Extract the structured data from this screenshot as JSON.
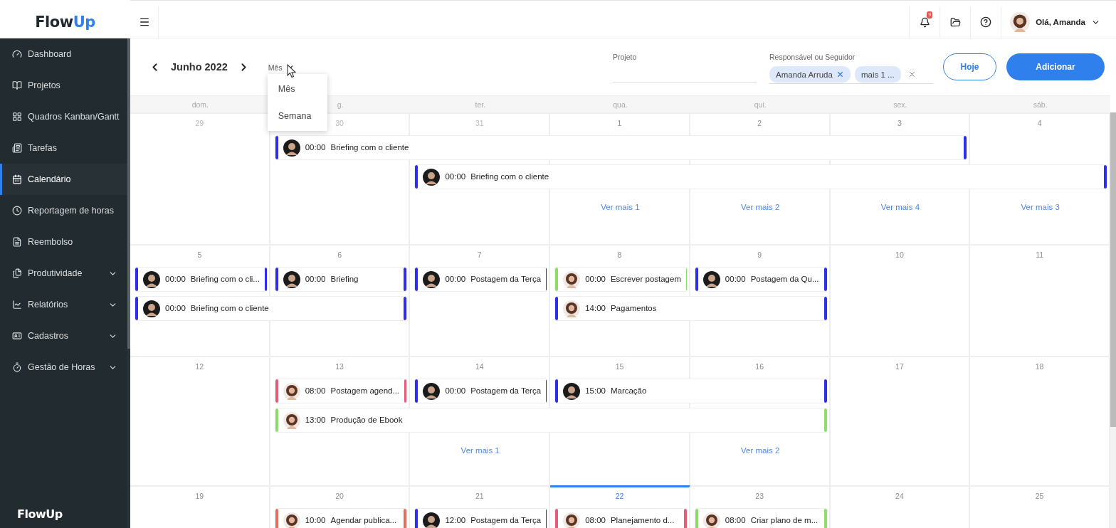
{
  "logo": {
    "text": "Flow",
    "accent": "Up"
  },
  "topbar": {
    "notifications": "9",
    "greeting": "Olá, Amanda"
  },
  "sidebar": {
    "items": [
      {
        "label": "Dashboard",
        "selected": false,
        "submenu": false
      },
      {
        "label": "Projetos",
        "selected": false,
        "submenu": false
      },
      {
        "label": "Quadros Kanban/Gantt",
        "selected": false,
        "submenu": false
      },
      {
        "label": "Tarefas",
        "selected": false,
        "submenu": false
      },
      {
        "label": "Calendário",
        "selected": true,
        "submenu": false
      },
      {
        "label": "Reportagem de horas",
        "selected": false,
        "submenu": false
      },
      {
        "label": "Reembolso",
        "selected": false,
        "submenu": false
      },
      {
        "label": "Produtividade",
        "selected": false,
        "submenu": true
      },
      {
        "label": "Relatórios",
        "selected": false,
        "submenu": true
      },
      {
        "label": "Cadastros",
        "selected": false,
        "submenu": true
      },
      {
        "label": "Gestão de Horas",
        "selected": false,
        "submenu": true
      }
    ],
    "footer_logo": "FlowUp"
  },
  "toolbar": {
    "month": "Junho 2022",
    "view": "Mês",
    "view_menu": [
      "Mês",
      "Semana"
    ],
    "project": {
      "label": "Projeto"
    },
    "assignee": {
      "label": "Responsável ou Seguidor",
      "chips": [
        {
          "text": "Amanda Arruda",
          "removable": true
        },
        {
          "text": "mais 1 ...",
          "removable": false
        }
      ]
    },
    "buttons": [
      {
        "label": "Hoje",
        "kind": "outline"
      },
      {
        "label": "Adicionar",
        "kind": "primary"
      }
    ]
  },
  "weekdays": [
    "dom.",
    "g.",
    "ter.",
    "qua.",
    "qui.",
    "sex.",
    "sáb."
  ],
  "weeks": [
    {
      "days": [
        {
          "date": "29",
          "muted": true,
          "today": false
        },
        {
          "date": "30",
          "muted": true,
          "today": false
        },
        {
          "date": "31",
          "muted": true,
          "today": false
        },
        {
          "date": "1",
          "muted": false,
          "today": false,
          "more": "Ver mais 1"
        },
        {
          "date": "2",
          "muted": false,
          "today": false,
          "more": "Ver mais 2"
        },
        {
          "date": "3",
          "muted": false,
          "today": false,
          "more": "Ver mais 4"
        },
        {
          "date": "4",
          "muted": false,
          "today": false,
          "more": "Ver mais 3"
        }
      ],
      "lanes": [
        [
          {
            "kind": "empty"
          },
          {
            "kind": "event",
            "time": "00:00",
            "title": "Briefing com o cliente",
            "color": "#2f2fe6",
            "curly_hair": false
          },
          {
            "kind": "cont"
          },
          {
            "kind": "cont"
          },
          {
            "kind": "cont"
          },
          {
            "kind": "cont"
          },
          {
            "kind": "empty"
          }
        ],
        [
          {
            "kind": "empty"
          },
          {
            "kind": "empty"
          },
          {
            "kind": "event",
            "time": "00:00",
            "title": "Briefing com o cliente",
            "color": "#2f2fe6",
            "curly_hair": false
          },
          {
            "kind": "cont"
          },
          {
            "kind": "cont"
          },
          {
            "kind": "cont"
          },
          {
            "kind": "cont"
          }
        ]
      ]
    },
    {
      "days": [
        {
          "date": "5",
          "muted": false,
          "today": false
        },
        {
          "date": "6",
          "muted": false,
          "today": false
        },
        {
          "date": "7",
          "muted": false,
          "today": false
        },
        {
          "date": "8",
          "muted": false,
          "today": false
        },
        {
          "date": "9",
          "muted": false,
          "today": false
        },
        {
          "date": "10",
          "muted": false,
          "today": false
        },
        {
          "date": "11",
          "muted": false,
          "today": false
        }
      ],
      "lanes": [
        [
          {
            "kind": "event",
            "time": "00:00",
            "title": "Briefing com o cli...",
            "color": "#2f2fe6",
            "curly_hair": false
          },
          {
            "kind": "event",
            "time": "00:00",
            "title": "Briefing",
            "color": "#2f2fe6",
            "curly_hair": false
          },
          {
            "kind": "event",
            "time": "00:00",
            "title": "Postagem da Terça",
            "color": "#2f2fe6",
            "curly_hair": false
          },
          {
            "kind": "event",
            "time": "00:00",
            "title": "Escrever postagem",
            "color": "#8fdc6a",
            "curly_hair": true
          },
          {
            "kind": "event",
            "time": "00:00",
            "title": "Postagem da Qu...",
            "color": "#2f2fe6",
            "curly_hair": false
          },
          {
            "kind": "empty"
          },
          {
            "kind": "empty"
          }
        ],
        [
          {
            "kind": "event",
            "time": "00:00",
            "title": "Briefing com o cliente",
            "color": "#2f2fe6",
            "curly_hair": false
          },
          {
            "kind": "cont"
          },
          {
            "kind": "empty"
          },
          {
            "kind": "event",
            "time": "14:00",
            "title": "Pagamentos",
            "color": "#2f2fe6",
            "curly_hair": true
          },
          {
            "kind": "cont"
          },
          {
            "kind": "empty"
          },
          {
            "kind": "empty"
          }
        ]
      ]
    },
    {
      "days": [
        {
          "date": "12",
          "muted": false,
          "today": false
        },
        {
          "date": "13",
          "muted": false,
          "today": false
        },
        {
          "date": "14",
          "muted": false,
          "today": false,
          "more": "Ver mais 1"
        },
        {
          "date": "15",
          "muted": false,
          "today": false
        },
        {
          "date": "16",
          "muted": false,
          "today": false,
          "more": "Ver mais 2"
        },
        {
          "date": "17",
          "muted": false,
          "today": false
        },
        {
          "date": "18",
          "muted": false,
          "today": false
        }
      ],
      "lanes": [
        [
          {
            "kind": "empty"
          },
          {
            "kind": "event",
            "time": "08:00",
            "title": "Postagem agend...",
            "color": "#e0607c",
            "curly_hair": true
          },
          {
            "kind": "event",
            "time": "00:00",
            "title": "Postagem da Terça",
            "color": "#2f2fe6",
            "curly_hair": false
          },
          {
            "kind": "event",
            "time": "15:00",
            "title": "Marcação",
            "color": "#2f2fe6",
            "curly_hair": false
          },
          {
            "kind": "cont"
          },
          {
            "kind": "empty"
          },
          {
            "kind": "empty"
          }
        ],
        [
          {
            "kind": "empty"
          },
          {
            "kind": "event",
            "time": "13:00",
            "title": "Produção de Ebook",
            "color": "#8fdc6a",
            "curly_hair": true
          },
          {
            "kind": "cont"
          },
          {
            "kind": "cont"
          },
          {
            "kind": "cont"
          },
          {
            "kind": "empty"
          },
          {
            "kind": "empty"
          }
        ]
      ]
    },
    {
      "days": [
        {
          "date": "19",
          "muted": false,
          "today": false
        },
        {
          "date": "20",
          "muted": false,
          "today": false
        },
        {
          "date": "21",
          "muted": false,
          "today": false
        },
        {
          "date": "22",
          "muted": false,
          "today": true
        },
        {
          "date": "23",
          "muted": false,
          "today": false
        },
        {
          "date": "24",
          "muted": false,
          "today": false
        },
        {
          "date": "25",
          "muted": false,
          "today": false
        }
      ],
      "lanes": [
        [
          {
            "kind": "empty"
          },
          {
            "kind": "event",
            "time": "10:00",
            "title": "Agendar publica...",
            "color": "#e07062",
            "curly_hair": true
          },
          {
            "kind": "event",
            "time": "12:00",
            "title": "Postagem da Terça",
            "color": "#2f2fe6",
            "curly_hair": false
          },
          {
            "kind": "event",
            "time": "08:00",
            "title": "Planejamento d...",
            "color": "#e0607c",
            "curly_hair": true
          },
          {
            "kind": "event",
            "time": "08:00",
            "title": "Criar plano de m...",
            "color": "#8fdc6a",
            "curly_hair": true
          },
          {
            "kind": "empty"
          },
          {
            "kind": "empty"
          }
        ]
      ]
    }
  ]
}
